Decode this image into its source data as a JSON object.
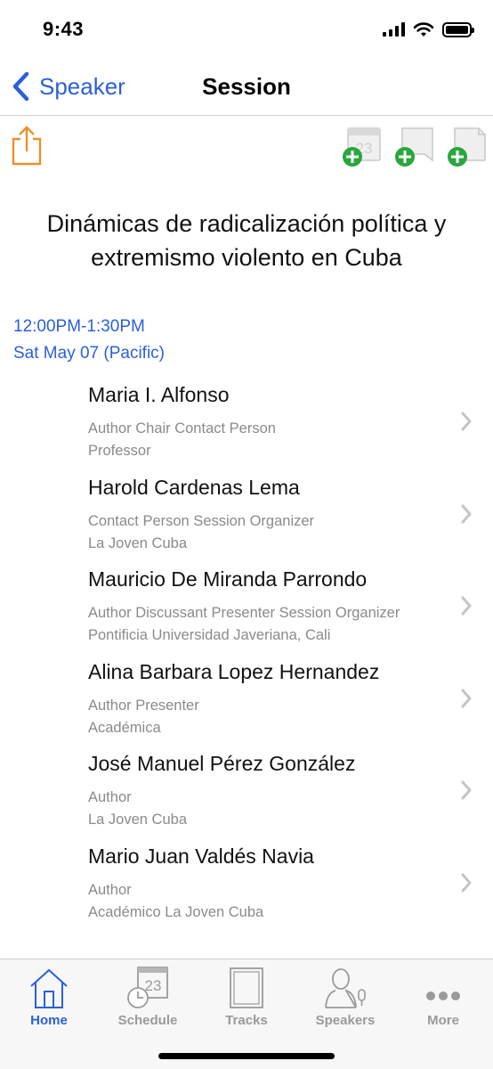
{
  "status_bar": {
    "time": "9:43"
  },
  "nav": {
    "back_label": "Speaker",
    "title": "Session"
  },
  "toolbar": {
    "share_icon": "share-icon",
    "add_calendar_icon": "add-to-calendar-icon",
    "add_bookmark_icon": "add-bookmark-icon",
    "add_note_icon": "add-note-icon",
    "calendar_day": "23",
    "plus_color": "#2aa63e",
    "share_color": "#e8912d"
  },
  "session": {
    "title": "Dinámicas de radicalización política y extremismo violento en Cuba",
    "time_range": "12:00PM-1:30PM",
    "date": "Sat May 07 (Pacific)"
  },
  "speakers": [
    {
      "name": "Maria I. Alfonso",
      "roles": "Author Chair Contact Person",
      "affiliation": "Professor"
    },
    {
      "name": "Harold Cardenas Lema",
      "roles": "Contact Person Session Organizer",
      "affiliation": "La Joven Cuba"
    },
    {
      "name": "Mauricio De Miranda Parrondo",
      "roles": "Author Discussant Presenter Session Organizer",
      "affiliation": "Pontificia Universidad Javeriana, Cali"
    },
    {
      "name": "Alina Barbara Lopez Hernandez",
      "roles": "Author Presenter",
      "affiliation": "Académica"
    },
    {
      "name": "José Manuel Pérez González",
      "roles": "Author",
      "affiliation": "La Joven Cuba"
    },
    {
      "name": "Mario Juan Valdés Navia",
      "roles": "Author",
      "affiliation": "Académico La Joven Cuba"
    }
  ],
  "tabs": [
    {
      "label": "Home",
      "icon": "home-icon",
      "active": true
    },
    {
      "label": "Schedule",
      "icon": "schedule-icon",
      "active": false,
      "calendar_day": "23"
    },
    {
      "label": "Tracks",
      "icon": "tracks-icon",
      "active": false
    },
    {
      "label": "Speakers",
      "icon": "speakers-icon",
      "active": false
    },
    {
      "label": "More",
      "icon": "more-icon",
      "active": false
    }
  ],
  "colors": {
    "accent": "#2b5fd9",
    "inactive": "#9a9a9a",
    "secondary_text": "#8a8a8a"
  }
}
